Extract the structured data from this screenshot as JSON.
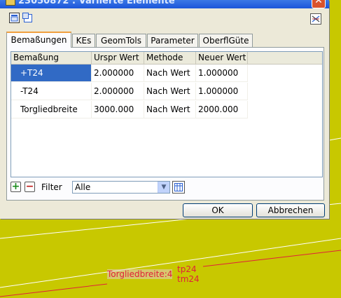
{
  "window": {
    "title": "23050872 : Variierte Elemente",
    "close_glyph": "✕"
  },
  "tabs": [
    "Bemaßungen",
    "KEs",
    "GeomTols",
    "Parameter",
    "OberflGüte"
  ],
  "grid": {
    "columns": [
      "Bemaßung",
      "Urspr Wert",
      "Methode",
      "Neuer Wert"
    ],
    "rows": [
      [
        "+T24",
        "2.000000",
        "Nach Wert",
        "1.000000"
      ],
      [
        "-T24",
        "2.000000",
        "Nach Wert",
        "1.000000"
      ],
      [
        "Torgliedbreite",
        "3000.000",
        "Nach Wert",
        "2000.000"
      ]
    ]
  },
  "filter": {
    "label": "Filter",
    "value": "Alle",
    "add_glyph": "+",
    "remove_glyph": "−",
    "dropdown_glyph": "▼"
  },
  "buttons": {
    "ok": "OK",
    "cancel": "Abbrechen"
  },
  "annotation": {
    "main": "Torgliedbreite:4",
    "sup": "tp24",
    "sub": "tm24"
  },
  "colors": {
    "background": "#c8c800",
    "selection": "#316ac5",
    "annotation": "#e0203a"
  }
}
